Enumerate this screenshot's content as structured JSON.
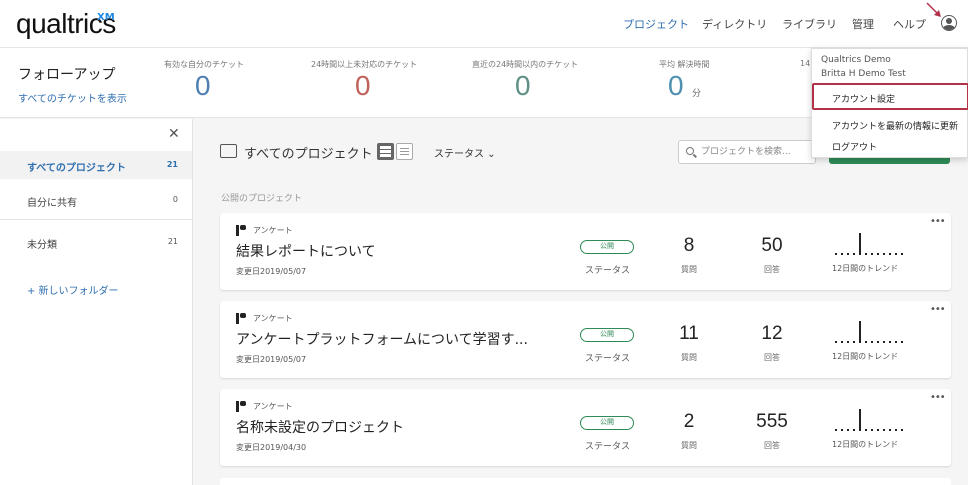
{
  "header": {
    "logo": "qualtrics",
    "logo_suffix": "XM",
    "nav": [
      "プロジェクト",
      "ディレクトリ",
      "ライブラリ",
      "管理",
      "ヘルプ"
    ],
    "active_nav": "プロジェクト"
  },
  "followup": {
    "title": "フォローアップ",
    "view_all": "すべてのチケットを表示",
    "stats": [
      {
        "label": "有効な自分のチケット",
        "value": "0",
        "color": "#4f7fb0"
      },
      {
        "label": "24時間以上未対応のチケット",
        "value": "0",
        "color": "#c0625a"
      },
      {
        "label": "直近の24時間以内のチケット",
        "value": "0",
        "color": "#5f9086"
      },
      {
        "label": "平均 解決時間",
        "value": "0",
        "unit": "分",
        "color": "#4f8fb0"
      }
    ],
    "partial_label": "14"
  },
  "account_menu": {
    "brand": "Qualtrics Demo",
    "user": "Britta H Demo Test",
    "items": [
      "アカウント設定",
      "アカウントを最新の情報に更新",
      "ログアウト"
    ],
    "highlighted": "アカウント設定"
  },
  "sidebar": {
    "items": [
      {
        "label": "すべてのプロジェクト",
        "count": "21",
        "active": true
      },
      {
        "label": "自分に共有",
        "count": "0"
      },
      {
        "label": "未分類",
        "count": "21"
      }
    ],
    "new_folder": "+ 新しいフォルダー"
  },
  "toolbar": {
    "title": "すべてのプロジェクト",
    "status_filter": "ステータス ⌄",
    "search_placeholder": "プロジェクトを検索..."
  },
  "section_label": "公開のプロジェクト",
  "projects": [
    {
      "type": "アンケート",
      "name": "結果レポートについて",
      "modified": "変更日2019/05/07",
      "status": "公開",
      "status_label": "ステータス",
      "questions": "8",
      "questions_label": "質問",
      "responses": "50",
      "responses_label": "回答",
      "trend_label": "12日間のトレンド",
      "trend": [
        0,
        0,
        0,
        0,
        1,
        0,
        0,
        0,
        0,
        0,
        0,
        0
      ]
    },
    {
      "type": "アンケート",
      "name": "アンケートプラットフォームについて学習す...",
      "modified": "変更日2019/05/07",
      "status": "公開",
      "status_label": "ステータス",
      "questions": "11",
      "questions_label": "質問",
      "responses": "12",
      "responses_label": "回答",
      "trend_label": "12日間のトレンド",
      "trend": [
        0,
        0,
        0,
        0,
        1,
        0,
        0,
        0,
        0,
        0,
        0,
        0
      ]
    },
    {
      "type": "アンケート",
      "name": "名称未設定のプロジェクト",
      "modified": "変更日2019/04/30",
      "status": "公開",
      "status_label": "ステータス",
      "questions": "2",
      "questions_label": "質問",
      "responses": "555",
      "responses_label": "回答",
      "trend_label": "12日間のトレンド",
      "trend": [
        0,
        0,
        0,
        0,
        1,
        0,
        0,
        0,
        0,
        0,
        0,
        0
      ]
    }
  ]
}
